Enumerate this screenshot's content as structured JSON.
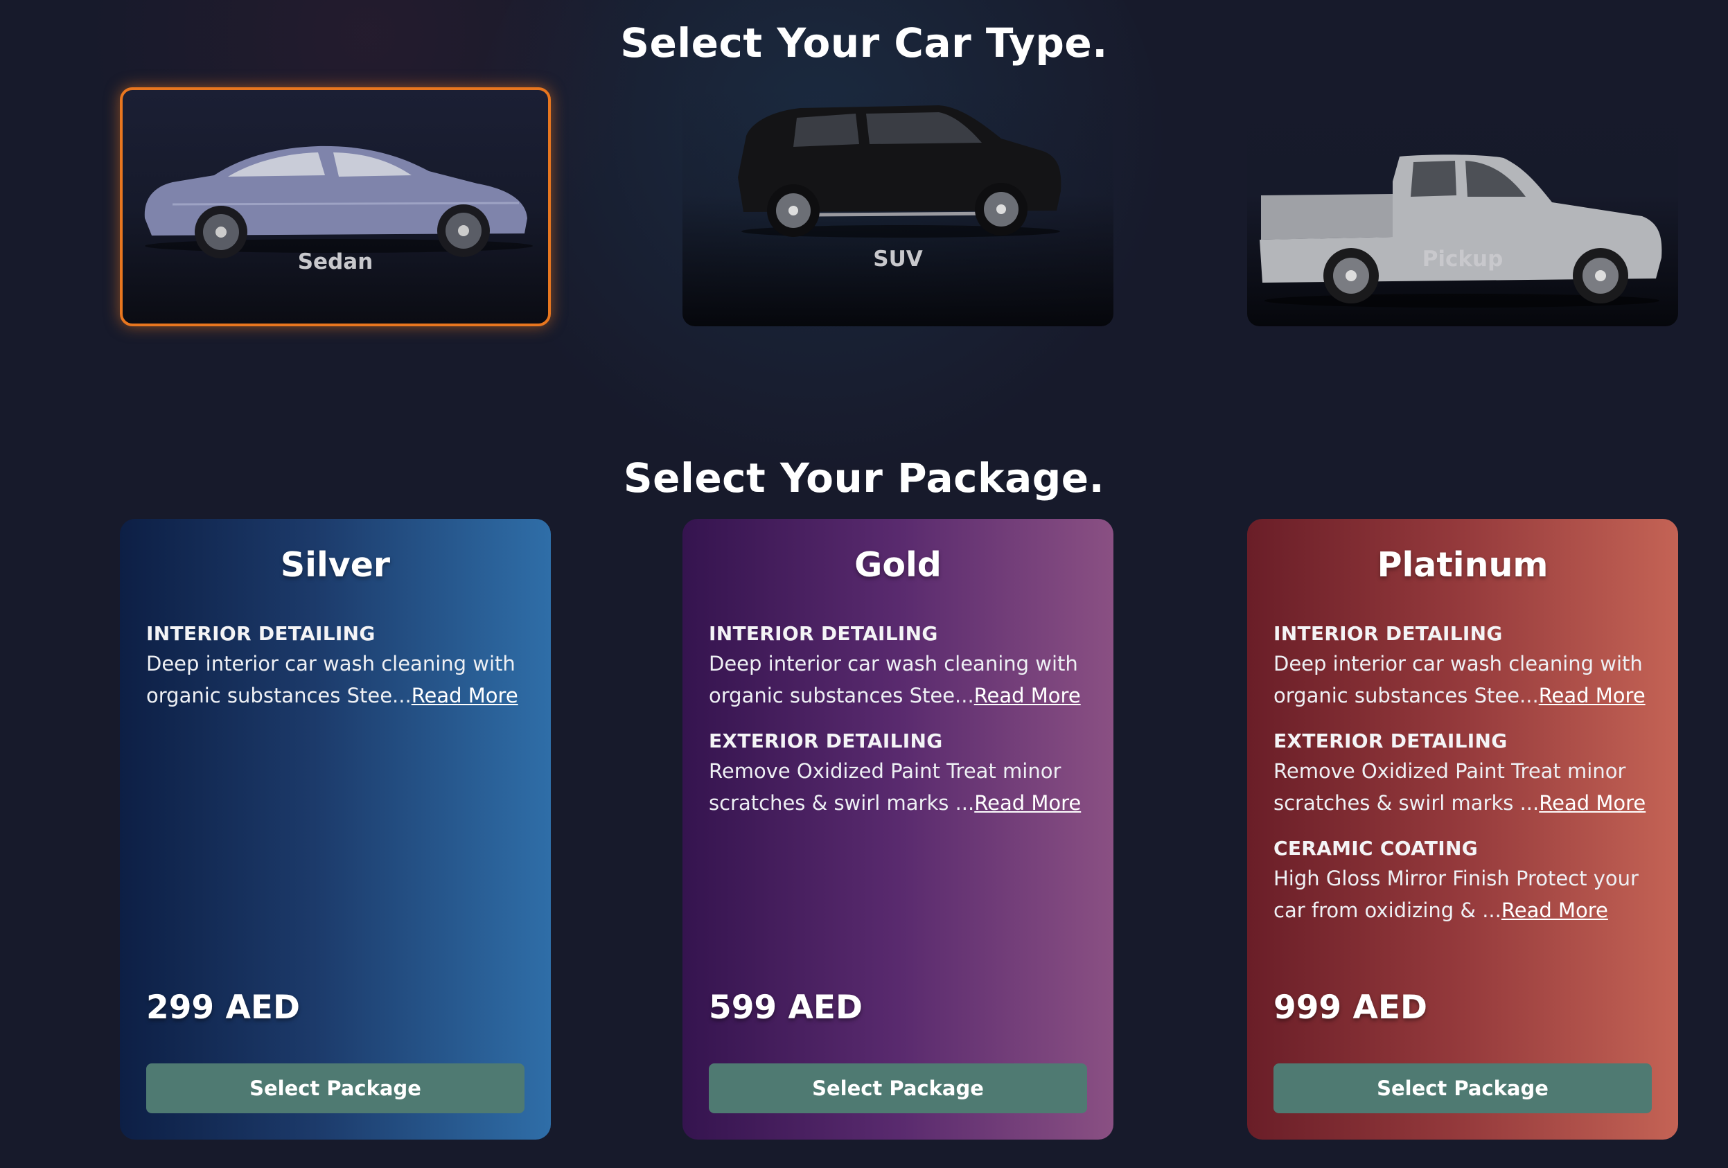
{
  "car_section": {
    "title": "Select Your Car Type.",
    "cars": [
      {
        "label": "Sedan",
        "selected": true,
        "icon": "sedan-car-image"
      },
      {
        "label": "SUV",
        "selected": false,
        "icon": "suv-car-image"
      },
      {
        "label": "Pickup",
        "selected": false,
        "icon": "pickup-truck-image"
      }
    ]
  },
  "package_section": {
    "title": "Select Your Package.",
    "packages": [
      {
        "name": "Silver",
        "features": [
          {
            "title": "INTERIOR DETAILING",
            "desc": "Deep interior car wash cleaning with organic substances Stee...",
            "link": "Read More"
          }
        ],
        "price": "299 AED",
        "button": "Select Package"
      },
      {
        "name": "Gold",
        "features": [
          {
            "title": "INTERIOR DETAILING",
            "desc": "Deep interior car wash cleaning with organic substances Stee...",
            "link": "Read More"
          },
          {
            "title": "EXTERIOR DETAILING",
            "desc": "Remove Oxidized Paint Treat minor scratches & swirl marks ...",
            "link": "Read More"
          }
        ],
        "price": "599 AED",
        "button": "Select Package"
      },
      {
        "name": "Platinum",
        "features": [
          {
            "title": "INTERIOR DETAILING",
            "desc": "Deep interior car wash cleaning with organic substances Stee...",
            "link": "Read More"
          },
          {
            "title": "EXTERIOR DETAILING",
            "desc": "Remove Oxidized Paint Treat minor scratches & swirl marks ...",
            "link": "Read More"
          },
          {
            "title": "CERAMIC COATING",
            "desc": "High Gloss Mirror Finish Protect your car from oxidizing & ...",
            "link": "Read More"
          }
        ],
        "price": "999 AED",
        "button": "Select Package"
      }
    ]
  },
  "colors": {
    "background": "#171a2b",
    "selected_border": "#e8761f",
    "button": "#4f7a72",
    "silver": "#2f6ea8",
    "gold": "#8a5083",
    "platinum": "#c46355"
  }
}
